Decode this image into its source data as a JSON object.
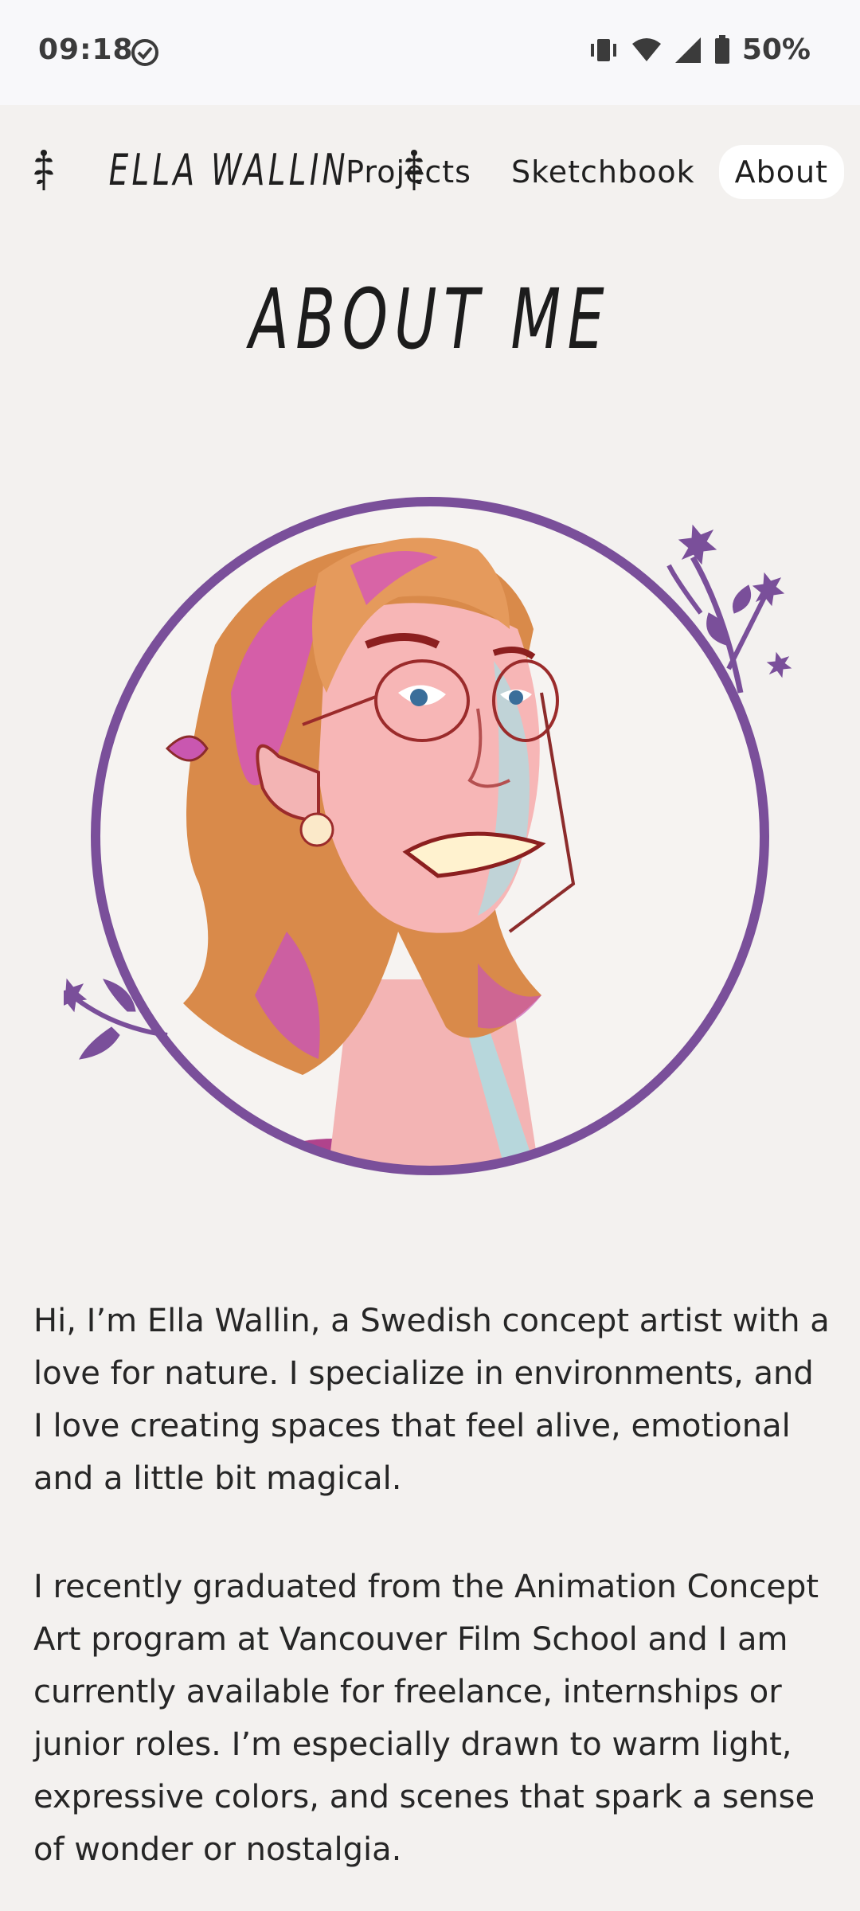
{
  "status_bar": {
    "time": "09:18",
    "battery": "50%",
    "icons": [
      "check-circle-icon",
      "vibrate-icon",
      "wifi-icon",
      "signal-icon",
      "battery-icon"
    ]
  },
  "nav": {
    "logo": "ELLA WALLIN",
    "links": [
      {
        "label": "Projects",
        "active": false
      },
      {
        "label": "Sketchbook",
        "active": false
      },
      {
        "label": "About",
        "active": true
      }
    ]
  },
  "page": {
    "title": "ABOUT ME",
    "paragraphs": [
      "Hi, I’m Ella Wallin, a Swedish concept artist with a love for nature. I specialize in environments, and I love creating spaces that feel alive, emotional and a little bit magical.",
      "I recently graduated from the Animation Concept Art program at Vancouver Film School and I am currently available for freelance, internships or junior roles. I’m especially drawn to warm light, expressive colors, and scenes that spark a sense of wonder or nostalgia."
    ]
  },
  "colors": {
    "background": "#f3f1ef",
    "accent_purple": "#7a4f9a",
    "text": "#262626"
  }
}
